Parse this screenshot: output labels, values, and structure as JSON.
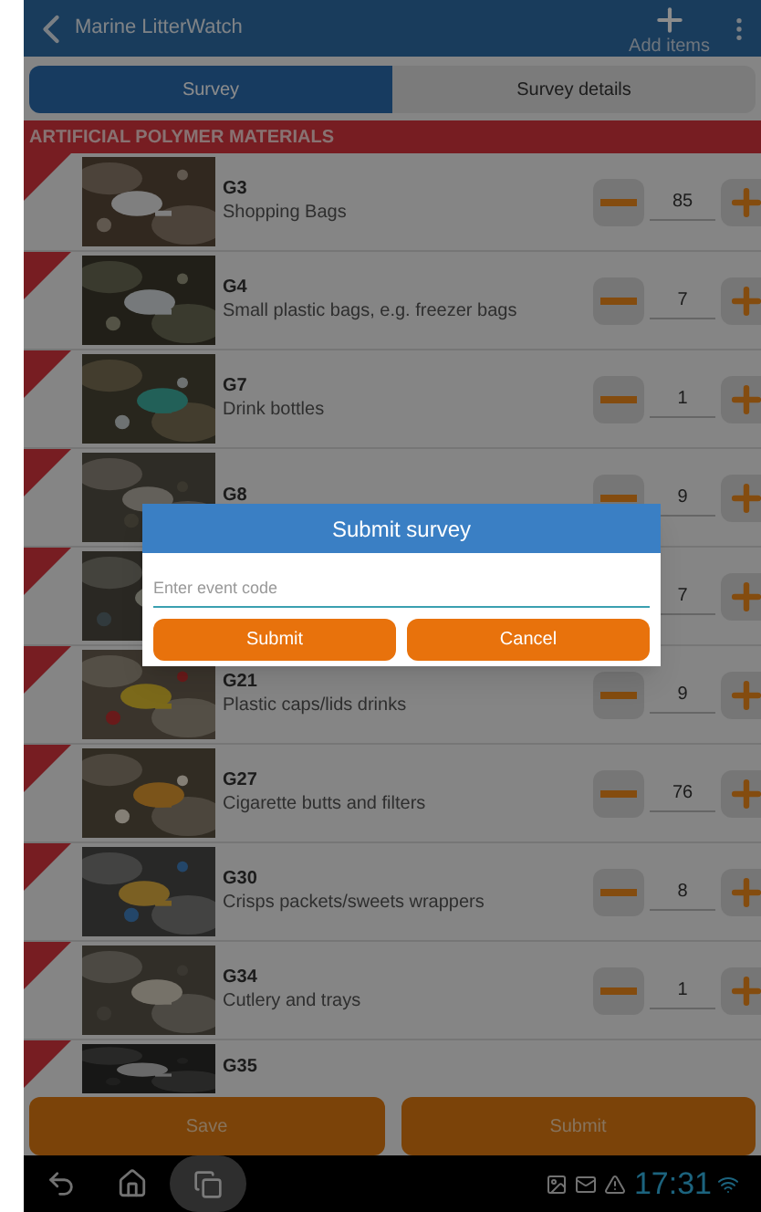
{
  "app_bar": {
    "title": "Marine LitterWatch",
    "action": "Add items"
  },
  "tabs": [
    {
      "label": "Survey",
      "selected": true
    },
    {
      "label": "Survey details",
      "selected": false
    }
  ],
  "section": "ARTIFICIAL POLYMER MATERIALS",
  "items": [
    {
      "code": "G3",
      "name": "Shopping Bags",
      "count": "85"
    },
    {
      "code": "G4",
      "name": "Small plastic bags, e.g. freezer bags",
      "count": "7"
    },
    {
      "code": "G7",
      "name": "Drink bottles",
      "count": "1"
    },
    {
      "code": "G8",
      "count": "9"
    },
    {
      "count": "7"
    },
    {
      "code": "G21",
      "name": "Plastic caps/lids drinks",
      "count": "9"
    },
    {
      "code": "G27",
      "name": "Cigarette butts and filters",
      "count": "76"
    },
    {
      "code": "G30",
      "name": "Crisps packets/sweets wrappers",
      "count": "8"
    },
    {
      "code": "G34",
      "name": "Cutlery and trays",
      "count": "1"
    },
    {
      "code": "G35"
    }
  ],
  "bottom_buttons": [
    "Save",
    "Submit"
  ],
  "dialog": {
    "title": "Submit survey",
    "placeholder": "Enter event code",
    "buttons": [
      "Submit",
      "Cancel"
    ]
  },
  "status_bar": {
    "time": "17:31"
  }
}
